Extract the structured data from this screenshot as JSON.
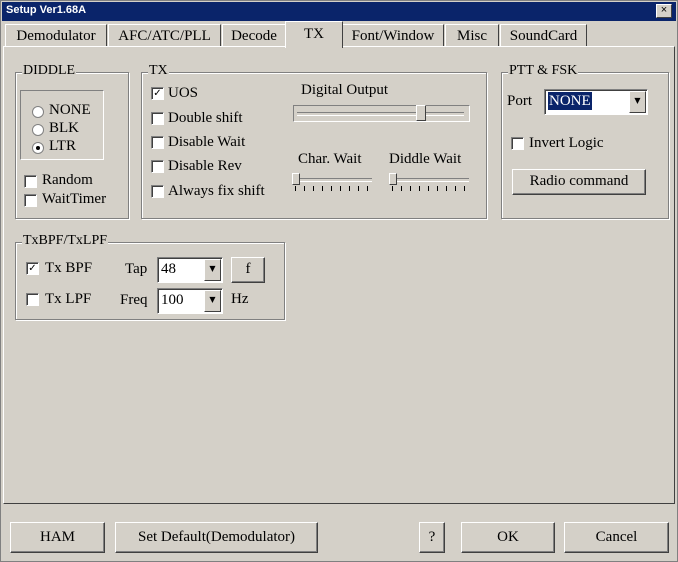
{
  "window": {
    "title": "Setup Ver1.68A",
    "close_glyph": "×"
  },
  "tabs": [
    {
      "label": "Demodulator",
      "active": false
    },
    {
      "label": "AFC/ATC/PLL",
      "active": false
    },
    {
      "label": "Decode",
      "active": false
    },
    {
      "label": "TX",
      "active": true
    },
    {
      "label": "Font/Window",
      "active": false
    },
    {
      "label": "Misc",
      "active": false
    },
    {
      "label": "SoundCard",
      "active": false
    }
  ],
  "diddle": {
    "title": "DIDDLE",
    "options": [
      {
        "label": "NONE",
        "selected": false
      },
      {
        "label": "BLK",
        "selected": false
      },
      {
        "label": "LTR",
        "selected": true
      }
    ],
    "random_label": "Random",
    "random_checked": false,
    "waittimer_label": "WaitTimer",
    "waittimer_checked": false
  },
  "tx": {
    "title": "TX",
    "checks": [
      {
        "label": "UOS",
        "checked": true
      },
      {
        "label": "Double shift",
        "checked": false
      },
      {
        "label": "Disable Wait",
        "checked": false
      },
      {
        "label": "Disable Rev",
        "checked": false
      },
      {
        "label": "Always fix shift",
        "checked": false
      }
    ],
    "digital_output_label": "Digital Output",
    "digital_output_level": 0.75,
    "char_wait_label": "Char. Wait",
    "char_wait_level": 0.0,
    "diddle_wait_label": "Diddle Wait",
    "diddle_wait_level": 0.0
  },
  "ptt": {
    "title": "PTT & FSK",
    "port_label": "Port",
    "port_value": "NONE",
    "invert_label": "Invert Logic",
    "invert_checked": false,
    "radio_button": "Radio command"
  },
  "filter": {
    "title": "TxBPF/TxLPF",
    "bpf_label": "Tx BPF",
    "bpf_checked": true,
    "tap_label": "Tap",
    "tap_value": "48",
    "f_button": "f",
    "lpf_label": "Tx LPF",
    "lpf_checked": false,
    "freq_label": "Freq",
    "freq_value": "100",
    "hz_label": "Hz"
  },
  "footer": {
    "ham": "HAM",
    "set_default": "Set Default(Demodulator)",
    "help": "?",
    "ok": "OK",
    "cancel": "Cancel"
  },
  "glyphs": {
    "check": "✓",
    "arrow": "▼"
  }
}
